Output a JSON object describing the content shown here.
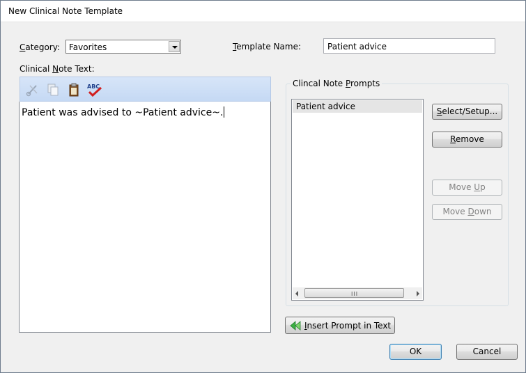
{
  "window": {
    "title": "New Clinical Note Template"
  },
  "category": {
    "label_prefix": "",
    "label_u": "C",
    "label_rest": "ategory:",
    "value": "Favorites"
  },
  "template_name": {
    "label_u": "T",
    "label_rest": "emplate Name:",
    "value": "Patient advice"
  },
  "note_text": {
    "label_pre": "Clinical ",
    "label_u": "N",
    "label_rest": "ote Text:",
    "content": "Patient was advised to ~Patient advice~."
  },
  "toolbar": {
    "icons": [
      "cut-icon",
      "copy-icon",
      "paste-icon",
      "spellcheck-icon"
    ]
  },
  "prompts": {
    "group_pre": "Clincal Note ",
    "group_u": "P",
    "group_rest": "rompts",
    "items": [
      "Patient advice"
    ],
    "scroll_grip": "III"
  },
  "buttons": {
    "select_u": "S",
    "select_rest": "elect/Setup...",
    "remove_u": "R",
    "remove_rest": "emove",
    "moveup_pre": "Move ",
    "moveup_u": "U",
    "moveup_rest": "p",
    "movedown_pre": "Move ",
    "movedown_u": "D",
    "movedown_rest": "own",
    "insert_u": "I",
    "insert_rest": "nsert Prompt in Text",
    "ok": "OK",
    "cancel": "Cancel"
  },
  "colors": {
    "toolbar_bg": "#c5d9f4",
    "list_selected": "#e5e5e5",
    "insert_arrow": "#3cb043"
  }
}
